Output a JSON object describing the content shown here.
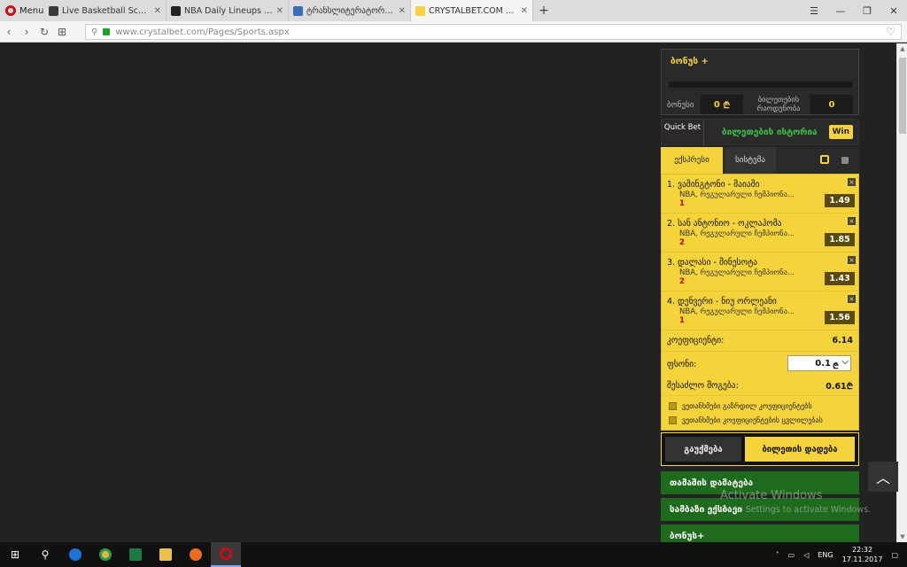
{
  "browser": {
    "menu_label": "Menu",
    "tabs": [
      {
        "label": "Live Basketball Scores - NBA",
        "color": "#3a3a3a"
      },
      {
        "label": "NBA Daily Lineups | RotoWire",
        "color": "#222222"
      },
      {
        "label": "ტრანსლიტერატორი -> თბ",
        "color": "#3d6fb8"
      },
      {
        "label": "CRYSTALBET.COM - ონლა",
        "color": "#f5d33b"
      }
    ],
    "active_tab_index": 3,
    "url": "www.crystalbet.com/Pages/Sports.aspx"
  },
  "panel": {
    "bonus_title": "ბონუს +",
    "bonus_label": "ბონუსი",
    "bonus_value": "0",
    "tickets_label": "ბილეთების რაოდენობა",
    "tickets_value": "0",
    "quick_bet": "Quick Bet",
    "history": "ბილეთების ისტორია",
    "win_badge": "Win",
    "tab_express": "ექსპრესი",
    "tab_system": "სისტემა",
    "bets": [
      {
        "num": "1.",
        "title": "ვაშინგტონი - მაიამი",
        "league": "NBA, რეგულარული ჩემპიონა...",
        "pick": "1",
        "odds": "1.49"
      },
      {
        "num": "2.",
        "title": "სან ანტონიო - ოკლაჰომა",
        "league": "NBA, რეგულარული ჩემპიონა...",
        "pick": "2",
        "odds": "1.85"
      },
      {
        "num": "3.",
        "title": "დალასი - მინესოტა",
        "league": "NBA, რეგულარული ჩემპიონა...",
        "pick": "2",
        "odds": "1.43"
      },
      {
        "num": "4.",
        "title": "დენვერი - ნიუ ორლეანი",
        "league": "NBA, რეგულარული ჩემპიონა...",
        "pick": "1",
        "odds": "1.56"
      }
    ],
    "coef_label": "კოეფიციენტი:",
    "coef_value": "6.14",
    "stake_label": "ფსონი:",
    "stake_value": "0.1",
    "possible_win_label": "შესაძლო მოგება:",
    "possible_win_value": "0.61",
    "check1": "ვეთანხმები გაზრდილ კოეფიციენტებს",
    "check2": "ვეთანხმები კოეფიციენტების ცვლილებას",
    "btn_clear": "გაუქმება",
    "btn_place": "ბილეთის დადება",
    "green_rows": [
      "თამაშის დამატება",
      "სამბაზი ექსბაეი",
      "ბონუს+"
    ]
  },
  "watermark": {
    "line1": "Activate Windows",
    "line2": "Go to Settings to activate Windows."
  },
  "taskbar": {
    "lang": "ENG",
    "time": "22:32",
    "date": "17.11.2017"
  }
}
